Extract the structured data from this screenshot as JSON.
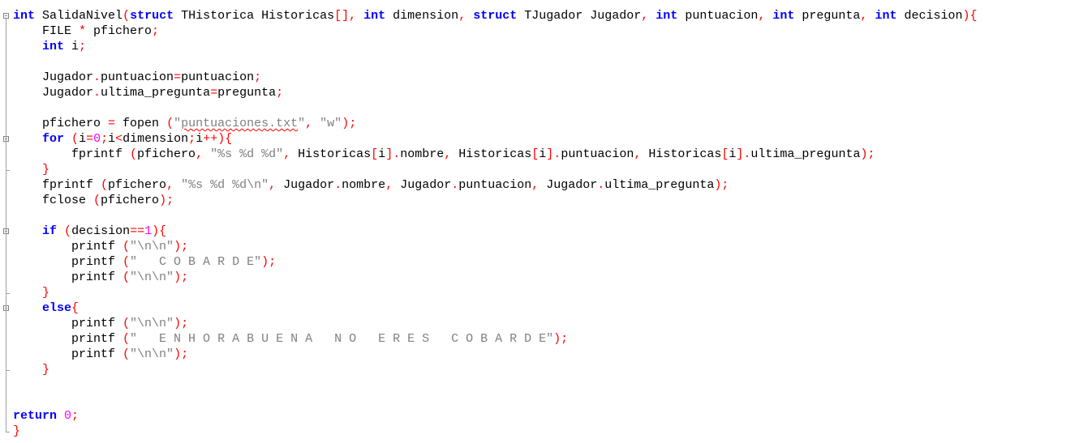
{
  "editor": {
    "lines": [
      {
        "fold": "start",
        "tokens": [
          {
            "t": "int",
            "c": "keyword"
          },
          {
            "t": " SalidaNivel",
            "c": "ident"
          },
          {
            "t": "(",
            "c": "op"
          },
          {
            "t": "struct",
            "c": "keyword"
          },
          {
            "t": " THistorica Historicas",
            "c": "ident"
          },
          {
            "t": "[],",
            "c": "op"
          },
          {
            "t": " ",
            "c": "ident"
          },
          {
            "t": "int",
            "c": "keyword"
          },
          {
            "t": " dimension",
            "c": "ident"
          },
          {
            "t": ",",
            "c": "op"
          },
          {
            "t": " ",
            "c": "ident"
          },
          {
            "t": "struct",
            "c": "keyword"
          },
          {
            "t": " TJugador Jugador",
            "c": "ident"
          },
          {
            "t": ",",
            "c": "op"
          },
          {
            "t": " ",
            "c": "ident"
          },
          {
            "t": "int",
            "c": "keyword"
          },
          {
            "t": " puntuacion",
            "c": "ident"
          },
          {
            "t": ",",
            "c": "op"
          },
          {
            "t": " ",
            "c": "ident"
          },
          {
            "t": "int",
            "c": "keyword"
          },
          {
            "t": " pregunta",
            "c": "ident"
          },
          {
            "t": ",",
            "c": "op"
          },
          {
            "t": " ",
            "c": "ident"
          },
          {
            "t": "int",
            "c": "keyword"
          },
          {
            "t": " decision",
            "c": "ident"
          },
          {
            "t": "){",
            "c": "op"
          }
        ]
      },
      {
        "tokens": [
          {
            "t": "    FILE ",
            "c": "ident"
          },
          {
            "t": "*",
            "c": "op"
          },
          {
            "t": " pfichero",
            "c": "ident"
          },
          {
            "t": ";",
            "c": "op"
          }
        ]
      },
      {
        "tokens": [
          {
            "t": "    ",
            "c": "ident"
          },
          {
            "t": "int",
            "c": "keyword"
          },
          {
            "t": " i",
            "c": "ident"
          },
          {
            "t": ";",
            "c": "op"
          }
        ]
      },
      {
        "tokens": []
      },
      {
        "tokens": [
          {
            "t": "    Jugador",
            "c": "ident"
          },
          {
            "t": ".",
            "c": "op"
          },
          {
            "t": "puntuacion",
            "c": "ident"
          },
          {
            "t": "=",
            "c": "op"
          },
          {
            "t": "puntuacion",
            "c": "ident"
          },
          {
            "t": ";",
            "c": "op"
          }
        ]
      },
      {
        "tokens": [
          {
            "t": "    Jugador",
            "c": "ident"
          },
          {
            "t": ".",
            "c": "op"
          },
          {
            "t": "ultima_pregunta",
            "c": "ident"
          },
          {
            "t": "=",
            "c": "op"
          },
          {
            "t": "pregunta",
            "c": "ident"
          },
          {
            "t": ";",
            "c": "op"
          }
        ]
      },
      {
        "tokens": []
      },
      {
        "tokens": [
          {
            "t": "    pfichero ",
            "c": "ident"
          },
          {
            "t": "=",
            "c": "op"
          },
          {
            "t": " fopen ",
            "c": "ident"
          },
          {
            "t": "(",
            "c": "op"
          },
          {
            "t": "\"",
            "c": "string"
          },
          {
            "t": "puntuaciones.txt",
            "c": "string-squiggle"
          },
          {
            "t": "\"",
            "c": "string"
          },
          {
            "t": ",",
            "c": "op"
          },
          {
            "t": " ",
            "c": "ident"
          },
          {
            "t": "\"w\"",
            "c": "string"
          },
          {
            "t": ");",
            "c": "op"
          }
        ]
      },
      {
        "fold": "start",
        "tokens": [
          {
            "t": "    ",
            "c": "ident"
          },
          {
            "t": "for",
            "c": "keyword"
          },
          {
            "t": " ",
            "c": "ident"
          },
          {
            "t": "(",
            "c": "op"
          },
          {
            "t": "i",
            "c": "ident"
          },
          {
            "t": "=",
            "c": "op"
          },
          {
            "t": "0",
            "c": "number"
          },
          {
            "t": ";",
            "c": "op"
          },
          {
            "t": "i",
            "c": "ident"
          },
          {
            "t": "<",
            "c": "op"
          },
          {
            "t": "dimension",
            "c": "ident"
          },
          {
            "t": ";",
            "c": "op"
          },
          {
            "t": "i",
            "c": "ident"
          },
          {
            "t": "++){",
            "c": "op"
          }
        ]
      },
      {
        "tokens": [
          {
            "t": "        fprintf ",
            "c": "ident"
          },
          {
            "t": "(",
            "c": "op"
          },
          {
            "t": "pfichero",
            "c": "ident"
          },
          {
            "t": ",",
            "c": "op"
          },
          {
            "t": " ",
            "c": "ident"
          },
          {
            "t": "\"%s %d %d\"",
            "c": "string"
          },
          {
            "t": ",",
            "c": "op"
          },
          {
            "t": " Historicas",
            "c": "ident"
          },
          {
            "t": "[",
            "c": "op"
          },
          {
            "t": "i",
            "c": "ident"
          },
          {
            "t": "].",
            "c": "op"
          },
          {
            "t": "nombre",
            "c": "ident"
          },
          {
            "t": ",",
            "c": "op"
          },
          {
            "t": " Historicas",
            "c": "ident"
          },
          {
            "t": "[",
            "c": "op"
          },
          {
            "t": "i",
            "c": "ident"
          },
          {
            "t": "].",
            "c": "op"
          },
          {
            "t": "puntuacion",
            "c": "ident"
          },
          {
            "t": ",",
            "c": "op"
          },
          {
            "t": " Historicas",
            "c": "ident"
          },
          {
            "t": "[",
            "c": "op"
          },
          {
            "t": "i",
            "c": "ident"
          },
          {
            "t": "].",
            "c": "op"
          },
          {
            "t": "ultima_pregunta",
            "c": "ident"
          },
          {
            "t": ");",
            "c": "op"
          }
        ]
      },
      {
        "fold": "end",
        "tokens": [
          {
            "t": "    ",
            "c": "ident"
          },
          {
            "t": "}",
            "c": "op"
          }
        ]
      },
      {
        "tokens": [
          {
            "t": "    fprintf ",
            "c": "ident"
          },
          {
            "t": "(",
            "c": "op"
          },
          {
            "t": "pfichero",
            "c": "ident"
          },
          {
            "t": ",",
            "c": "op"
          },
          {
            "t": " ",
            "c": "ident"
          },
          {
            "t": "\"%s %d %d\\n\"",
            "c": "string"
          },
          {
            "t": ",",
            "c": "op"
          },
          {
            "t": " Jugador",
            "c": "ident"
          },
          {
            "t": ".",
            "c": "op"
          },
          {
            "t": "nombre",
            "c": "ident"
          },
          {
            "t": ",",
            "c": "op"
          },
          {
            "t": " Jugador",
            "c": "ident"
          },
          {
            "t": ".",
            "c": "op"
          },
          {
            "t": "puntuacion",
            "c": "ident"
          },
          {
            "t": ",",
            "c": "op"
          },
          {
            "t": " Jugador",
            "c": "ident"
          },
          {
            "t": ".",
            "c": "op"
          },
          {
            "t": "ultima_pregunta",
            "c": "ident"
          },
          {
            "t": ");",
            "c": "op"
          }
        ]
      },
      {
        "tokens": [
          {
            "t": "    fclose ",
            "c": "ident"
          },
          {
            "t": "(",
            "c": "op"
          },
          {
            "t": "pfichero",
            "c": "ident"
          },
          {
            "t": ");",
            "c": "op"
          }
        ]
      },
      {
        "tokens": []
      },
      {
        "fold": "start",
        "tokens": [
          {
            "t": "    ",
            "c": "ident"
          },
          {
            "t": "if",
            "c": "keyword"
          },
          {
            "t": " ",
            "c": "ident"
          },
          {
            "t": "(",
            "c": "op"
          },
          {
            "t": "decision",
            "c": "ident"
          },
          {
            "t": "==",
            "c": "op"
          },
          {
            "t": "1",
            "c": "number"
          },
          {
            "t": "){",
            "c": "op"
          }
        ]
      },
      {
        "tokens": [
          {
            "t": "        printf ",
            "c": "ident"
          },
          {
            "t": "(",
            "c": "op"
          },
          {
            "t": "\"\\n\\n\"",
            "c": "string"
          },
          {
            "t": ");",
            "c": "op"
          }
        ]
      },
      {
        "tokens": [
          {
            "t": "        printf ",
            "c": "ident"
          },
          {
            "t": "(",
            "c": "op"
          },
          {
            "t": "\"   C O B A R D E\"",
            "c": "string"
          },
          {
            "t": ");",
            "c": "op"
          }
        ]
      },
      {
        "tokens": [
          {
            "t": "        printf ",
            "c": "ident"
          },
          {
            "t": "(",
            "c": "op"
          },
          {
            "t": "\"\\n\\n\"",
            "c": "string"
          },
          {
            "t": ");",
            "c": "op"
          }
        ]
      },
      {
        "fold": "end",
        "tokens": [
          {
            "t": "    ",
            "c": "ident"
          },
          {
            "t": "}",
            "c": "op"
          }
        ]
      },
      {
        "fold": "start",
        "tokens": [
          {
            "t": "    ",
            "c": "ident"
          },
          {
            "t": "else",
            "c": "keyword"
          },
          {
            "t": "{",
            "c": "op"
          }
        ]
      },
      {
        "tokens": [
          {
            "t": "        printf ",
            "c": "ident"
          },
          {
            "t": "(",
            "c": "op"
          },
          {
            "t": "\"\\n\\n\"",
            "c": "string"
          },
          {
            "t": ");",
            "c": "op"
          }
        ]
      },
      {
        "tokens": [
          {
            "t": "        printf ",
            "c": "ident"
          },
          {
            "t": "(",
            "c": "op"
          },
          {
            "t": "\"   E N H O R A B U E N A   N O   E R E S   C O B A R D E\"",
            "c": "string"
          },
          {
            "t": ");",
            "c": "op"
          }
        ]
      },
      {
        "tokens": [
          {
            "t": "        printf ",
            "c": "ident"
          },
          {
            "t": "(",
            "c": "op"
          },
          {
            "t": "\"\\n\\n\"",
            "c": "string"
          },
          {
            "t": ");",
            "c": "op"
          }
        ]
      },
      {
        "fold": "end",
        "tokens": [
          {
            "t": "    ",
            "c": "ident"
          },
          {
            "t": "}",
            "c": "op"
          }
        ]
      },
      {
        "tokens": []
      },
      {
        "tokens": []
      },
      {
        "tokens": [
          {
            "t": "return",
            "c": "keyword"
          },
          {
            "t": " ",
            "c": "ident"
          },
          {
            "t": "0",
            "c": "number"
          },
          {
            "t": ";",
            "c": "op"
          }
        ]
      },
      {
        "fold": "end",
        "tokens": [
          {
            "t": "}",
            "c": "op"
          }
        ]
      }
    ]
  }
}
